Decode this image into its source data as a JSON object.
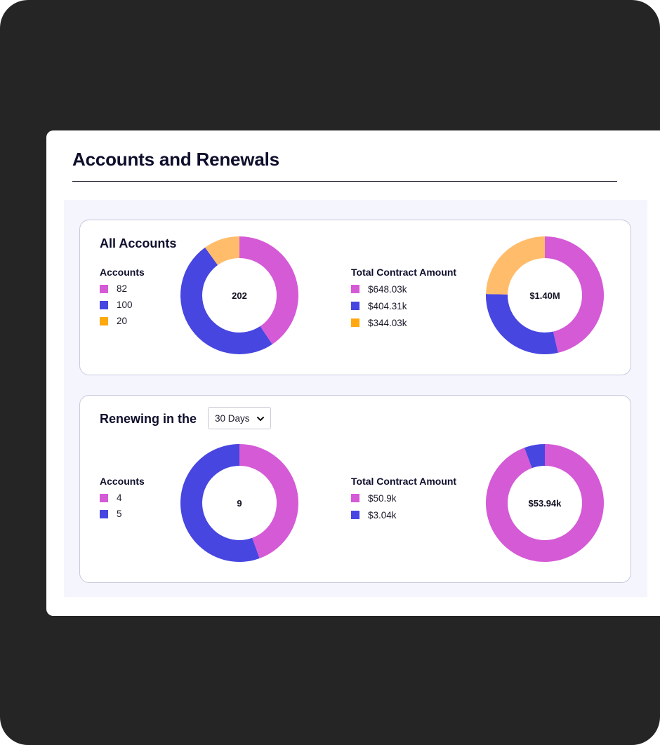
{
  "page": {
    "title": "Accounts and Renewals"
  },
  "colors": {
    "magenta": "#d55ad6",
    "blue": "#4746e0",
    "orange_swatch": "#ffa80f",
    "orange_slice": "#ffbd6b"
  },
  "all_accounts": {
    "title": "All Accounts",
    "accounts": {
      "heading": "Accounts",
      "total_label": "202",
      "legend": [
        {
          "label": "82",
          "color": "#d55ad6"
        },
        {
          "label": "100",
          "color": "#4746e0"
        },
        {
          "label": "20",
          "color": "#ffa80f"
        }
      ]
    },
    "contract": {
      "heading": "Total Contract Amount",
      "total_label": "$1.40M",
      "legend": [
        {
          "label": "$648.03k",
          "color": "#d55ad6"
        },
        {
          "label": "$404.31k",
          "color": "#4746e0"
        },
        {
          "label": "$344.03k",
          "color": "#ffa80f"
        }
      ]
    }
  },
  "renewing": {
    "title": "Renewing in the",
    "period_select": {
      "value": "30 Days"
    },
    "accounts": {
      "heading": "Accounts",
      "total_label": "9",
      "legend": [
        {
          "label": "4",
          "color": "#d55ad6"
        },
        {
          "label": "5",
          "color": "#4746e0"
        }
      ]
    },
    "contract": {
      "heading": "Total Contract Amount",
      "total_label": "$53.94k",
      "legend": [
        {
          "label": "$50.9k",
          "color": "#d55ad6"
        },
        {
          "label": "$3.04k",
          "color": "#4746e0"
        }
      ]
    }
  },
  "chart_data": [
    {
      "type": "pie",
      "categories": [
        "82",
        "100",
        "20"
      ],
      "values": [
        82,
        100,
        20
      ],
      "colors": [
        "#d55ad6",
        "#4746e0",
        "#ffbd6b"
      ],
      "center_label": "202"
    },
    {
      "type": "pie",
      "categories": [
        "$648.03k",
        "$404.31k",
        "$344.03k"
      ],
      "values": [
        648.03,
        404.31,
        344.03
      ],
      "colors": [
        "#d55ad6",
        "#4746e0",
        "#ffbd6b"
      ],
      "center_label": "$1.40M"
    },
    {
      "type": "pie",
      "categories": [
        "4",
        "5"
      ],
      "values": [
        4,
        5
      ],
      "colors": [
        "#d55ad6",
        "#4746e0"
      ],
      "center_label": "9"
    },
    {
      "type": "pie",
      "categories": [
        "$50.9k",
        "$3.04k"
      ],
      "values": [
        50.9,
        3.04
      ],
      "colors": [
        "#d55ad6",
        "#4746e0"
      ],
      "center_label": "$53.94k"
    }
  ]
}
